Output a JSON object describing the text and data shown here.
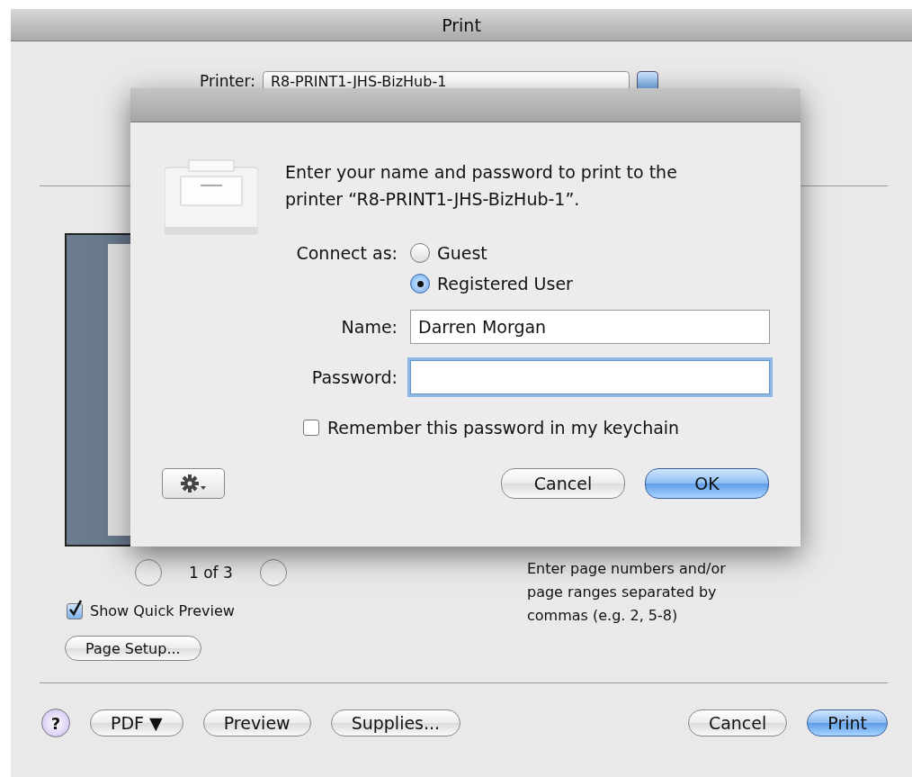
{
  "window": {
    "title": "Print"
  },
  "printer": {
    "label": "Printer:",
    "value": "R8-PRINT1-JHS-BizHub-1"
  },
  "preview": {
    "page_indicator": "1 of 3",
    "show_quick_preview": {
      "label": "Show Quick Preview",
      "checked": true
    },
    "page_setup_button": "Page Setup..."
  },
  "pages_hint": "Enter page numbers and/or page ranges separated by commas (e.g. 2, 5-8)",
  "help_button": "?",
  "bottom_left_buttons": [
    {
      "label": "PDF ▼",
      "kind": "plain"
    },
    {
      "label": "Preview",
      "kind": "plain"
    },
    {
      "label": "Supplies...",
      "kind": "plain"
    }
  ],
  "bottom_right_buttons": [
    {
      "label": "Cancel",
      "kind": "plain"
    },
    {
      "label": "Print",
      "kind": "default"
    }
  ],
  "sheet": {
    "message": "Enter your name and password to print to the printer “R8-PRINT1-JHS-BizHub-1”.",
    "connect_label": "Connect as:",
    "options": [
      {
        "label": "Guest",
        "selected": false
      },
      {
        "label": "Registered User",
        "selected": true
      }
    ],
    "fields": [
      {
        "label": "Name:",
        "value": "Darren Morgan",
        "focused": false
      },
      {
        "label": "Password:",
        "focused": true
      }
    ],
    "remember": {
      "label": "Remember this password in my keychain",
      "checked": false
    },
    "buttons": [
      {
        "label": "Cancel",
        "kind": "plain"
      },
      {
        "label": "OK",
        "kind": "default"
      }
    ]
  }
}
